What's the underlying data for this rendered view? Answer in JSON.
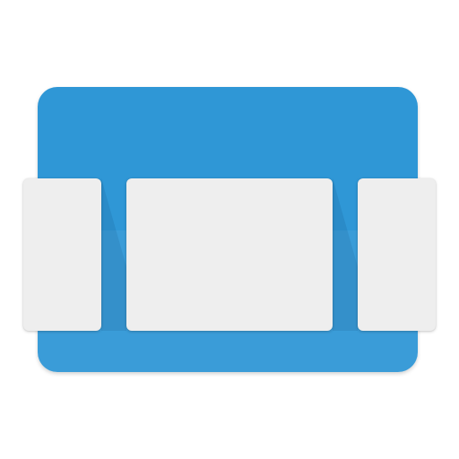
{
  "icon": {
    "name": "carousel-view-icon",
    "colors": {
      "panel_top": "#2F97D6",
      "panel_bottom": "#3A9CD8",
      "card": "#EEEEEE"
    }
  }
}
